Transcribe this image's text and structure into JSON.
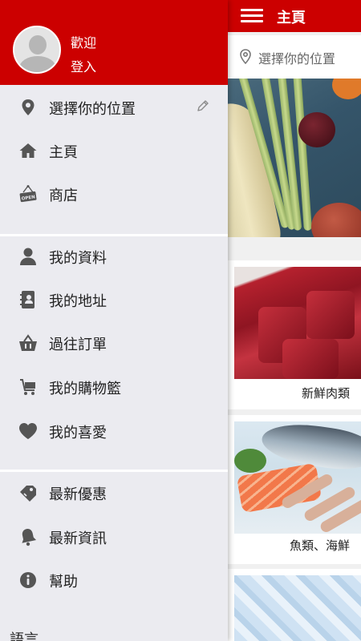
{
  "app": {
    "colors": {
      "brand_red": "#cc0000",
      "drawer_bg": "#ebebf0",
      "icon_gray": "#555555"
    }
  },
  "main": {
    "menu_icon": "hamburger-icon",
    "title": "主頁",
    "location_icon": "map-pin-icon",
    "location_placeholder": "選擇你的位置",
    "categories": [
      {
        "label": "新鮮肉類"
      },
      {
        "label": "魚類、海鮮"
      }
    ]
  },
  "drawer": {
    "welcome": "歡迎",
    "login": "登入",
    "location_item": {
      "label": "選擇你的位置",
      "icon": "map-pin-icon",
      "edit_icon": "pencil-icon"
    },
    "nav": [
      {
        "label": "主頁",
        "icon": "home-icon"
      },
      {
        "label": "商店",
        "icon": "open-sign-icon"
      }
    ],
    "account": [
      {
        "label": "我的資料",
        "icon": "person-icon"
      },
      {
        "label": "我的地址",
        "icon": "address-book-icon"
      },
      {
        "label": "過往訂單",
        "icon": "basket-icon"
      },
      {
        "label": "我的購物籃",
        "icon": "cart-icon"
      },
      {
        "label": "我的喜愛",
        "icon": "heart-icon"
      }
    ],
    "info": [
      {
        "label": "最新優惠",
        "icon": "tag-icon"
      },
      {
        "label": "最新資訊",
        "icon": "bell-icon"
      },
      {
        "label": "幫助",
        "icon": "info-icon"
      }
    ],
    "language_heading": "語言"
  }
}
